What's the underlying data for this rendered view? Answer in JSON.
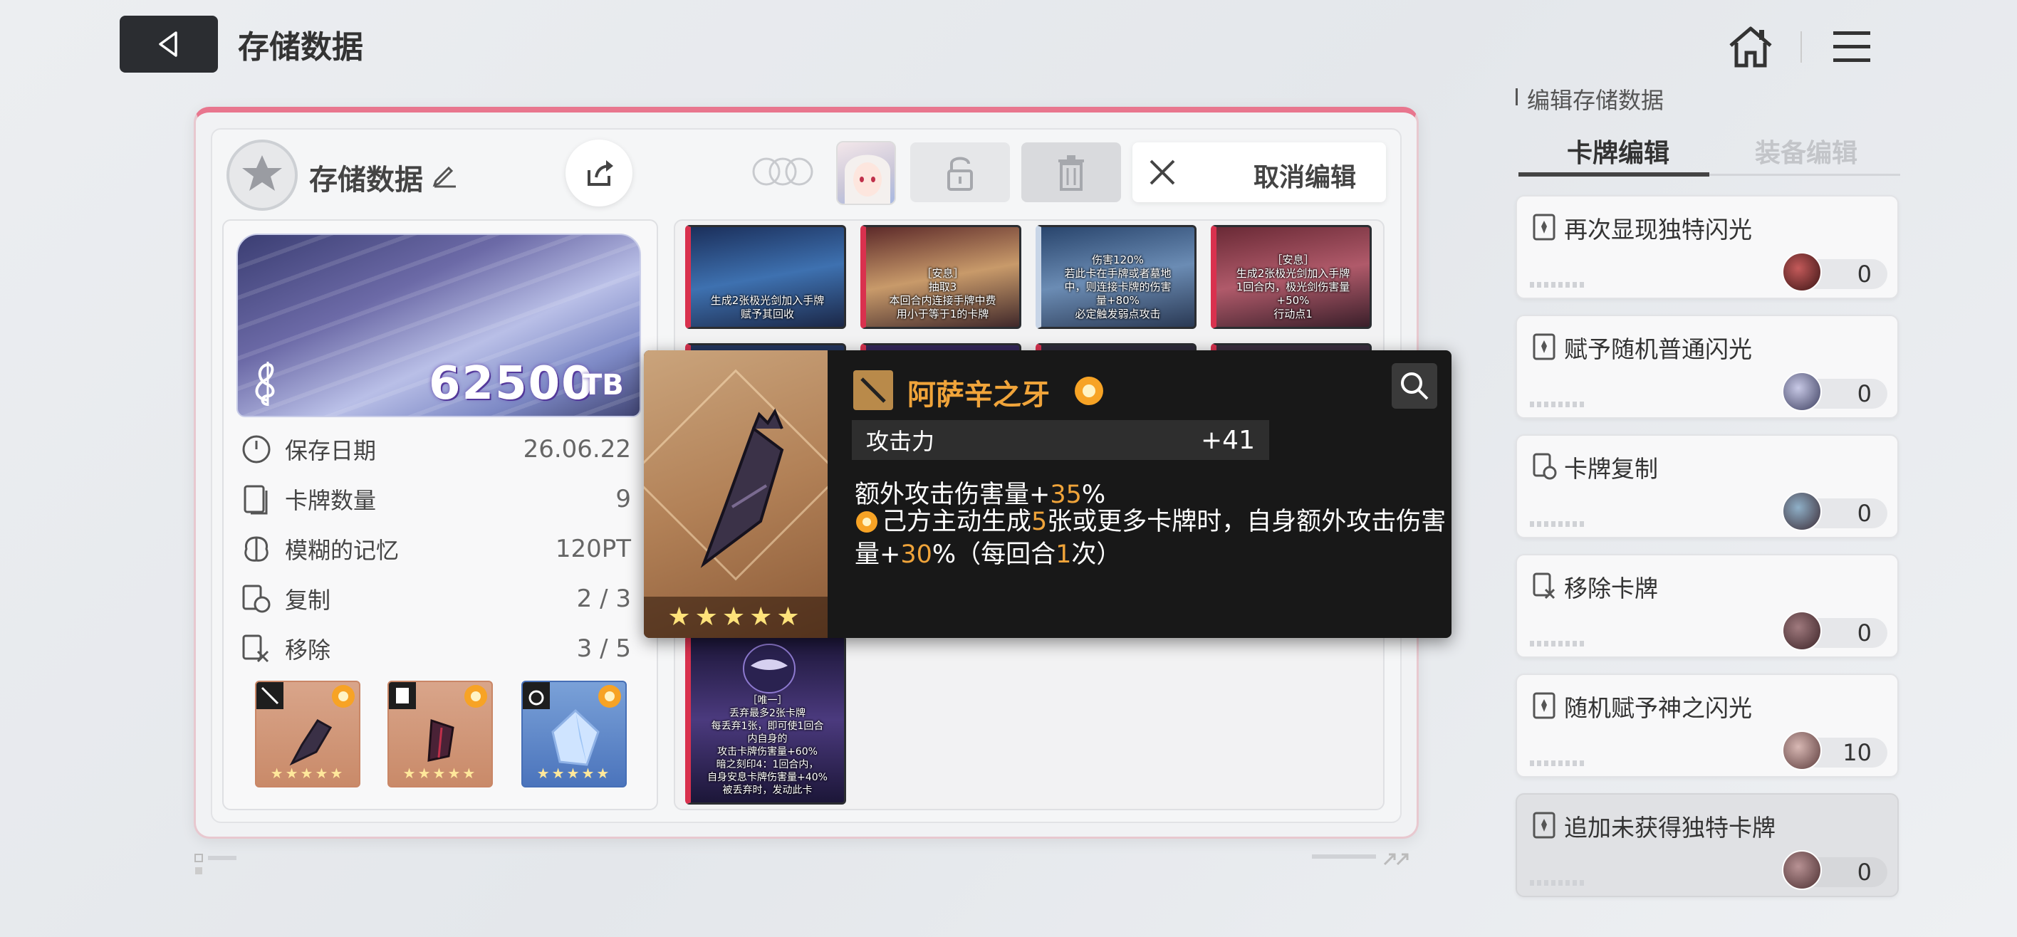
{
  "header": {
    "title": "存储数据"
  },
  "save": {
    "name": "存储数据",
    "tb_value": "62500",
    "tb_unit": "TB",
    "cancel_label": "取消编辑",
    "stats": [
      {
        "key": "保存日期",
        "value": "26.06.22",
        "icon": "clock-icon"
      },
      {
        "key": "卡牌数量",
        "value": "9",
        "icon": "cards-icon"
      },
      {
        "key": "模糊的记忆",
        "value": "120PT",
        "icon": "brain-icon"
      },
      {
        "key": "复制",
        "value": "2 / 3",
        "icon": "copy-card-icon"
      },
      {
        "key": "移除",
        "value": "3 / 5",
        "icon": "remove-card-icon"
      }
    ]
  },
  "cards": [
    {
      "text": "生成2张极光剑加入手牌\n赋予其回收"
    },
    {
      "text": "［安息］\n抽取3\n本回合内连接手牌中费\n用小于等于1的卡牌"
    },
    {
      "text": "伤害120%\n若此卡在手牌或者墓地\n中，则连接卡牌的伤害\n量+80%\n必定触发弱点攻击"
    },
    {
      "text": "［安息］\n生成2张极光剑加入手牌\n1回合内，极光剑伤害量\n+50%\n行动点1"
    },
    {
      "text": "［唯一］\n丢弃最多2张卡牌\n每丢弃1张，即可使1回合\n内自身的\n攻击卡牌伤害量+60%\n暗之刻印4：1回合内，\n自身安息卡牌伤害量+40%\n被丢弃时，发动此卡"
    }
  ],
  "tooltip": {
    "name": "阿萨辛之牙",
    "stars": "★★★★★",
    "stat_key": "攻击力",
    "stat_value": "+41",
    "line1_pre": "额外攻击伤害量+",
    "line1_num": "35",
    "line1_post": "%",
    "line2_a": "己方主动生成",
    "line2_num1": "5",
    "line2_b": "张或更多卡牌时，自身额外攻击伤害量+",
    "line2_num2": "30",
    "line2_c": "%（每回合",
    "line2_num3": "1",
    "line2_d": "次）"
  },
  "equipment": [
    {
      "stars": "★★★★★"
    },
    {
      "stars": "★★★★★"
    },
    {
      "stars": "★★★★★"
    }
  ],
  "edit_panel": {
    "title": "编辑存储数据",
    "tabs": [
      "卡牌编辑",
      "装备编辑"
    ],
    "items": [
      {
        "label": "再次显现独特闪光",
        "count": "0",
        "color": "#8a2a2a"
      },
      {
        "label": "赋予随机普通闪光",
        "count": "0",
        "color": "#6a6d8f"
      },
      {
        "label": "卡牌复制",
        "count": "0",
        "color": "#5d4b52"
      },
      {
        "label": "移除卡牌",
        "count": "0",
        "color": "#6b4b4f"
      },
      {
        "label": "随机赋予神之闪光",
        "count": "10",
        "color": "#8a6a6a"
      },
      {
        "label": "追加未获得独特卡牌",
        "count": "0",
        "color": "#7d5a5c"
      }
    ]
  },
  "colors": {
    "accent_pink": "#e8768e",
    "tooltip_gold": "#f0a43a",
    "card_red": "#d9314e"
  }
}
